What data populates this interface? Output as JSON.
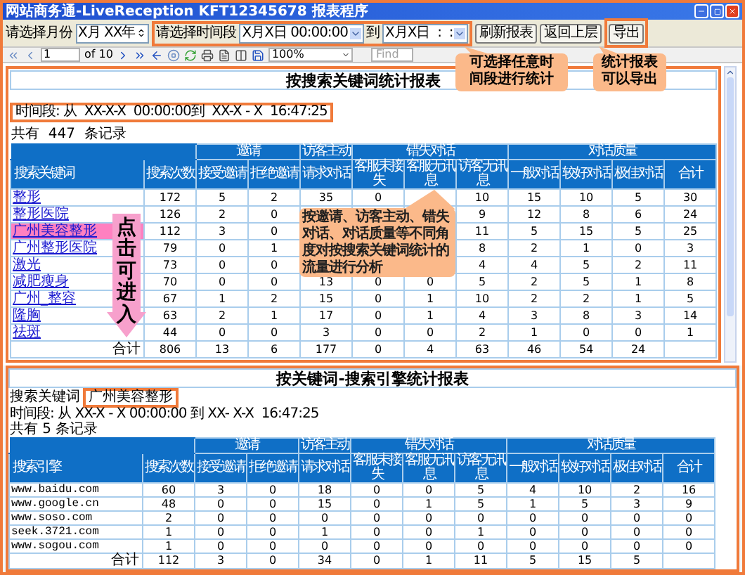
{
  "window": {
    "title": "网站商务通-LiveReception KFT12345678 报表程序"
  },
  "toolbar": {
    "month_label": "请选择月份",
    "month_value": "X月 XX年",
    "period_label": "请选择时间段",
    "period_from": "X月X日 00:00:00",
    "to_label": "到",
    "period_to": "X月X日  :  :",
    "buttons": [
      "刷新报表",
      "返回上层",
      "导出"
    ]
  },
  "report_toolbar": {
    "page": "1",
    "page_count": "of 10",
    "zoom": "100%",
    "find": "Find"
  },
  "callouts": [
    "可选择任意时间段进行统计",
    "统计报表可以导出",
    "按邀请、访客主动、错失对话、对话质量等不同角度对按搜索关键词统计的流量进行分析"
  ],
  "arrow": {
    "label": "点击可进入"
  },
  "report1": {
    "title": "按搜索关键词统计报表",
    "time_range": "时间段: 从  XX-X-X  00:00:00到  XX-X - X  16:47:25",
    "record_count": "共有  447  条记录",
    "columns": [
      {
        "label": "搜索关键词"
      },
      {
        "label": "搜索次数"
      },
      {
        "group": "邀请",
        "columns": [
          {
            "label": "接受邀请"
          },
          {
            "label": "拒绝邀请"
          }
        ]
      },
      {
        "group": "访客主动",
        "columns": [
          {
            "label": "请求对话"
          }
        ]
      },
      {
        "group": "错失对话",
        "columns": [
          {
            "label": "客服未接失"
          },
          {
            "label": "客服无讯息"
          },
          {
            "label": "访客无讯息"
          }
        ]
      },
      {
        "group": "对话质量",
        "columns": [
          {
            "label": "一般对话"
          },
          {
            "label": "较好对话"
          },
          {
            "label": "极佳对话"
          },
          {
            "label": "合计"
          }
        ]
      }
    ],
    "rows": [
      {
        "label": "整形",
        "selected": false,
        "cells": {
          "count": "172",
          "accept": "5",
          "decline": "2",
          "request": "35",
          "agent_missed": "0",
          "visitor_silent": "10",
          "normal": "15",
          "good": "10",
          "excellent": "5",
          "total": "30"
        }
      },
      {
        "label": "整形医院",
        "selected": false,
        "cells": {
          "count": "126",
          "accept": "2",
          "decline": "0",
          "visitor_silent": "9",
          "normal": "12",
          "good": "8",
          "excellent": "6",
          "total": "24"
        }
      },
      {
        "label": "广州美容整形",
        "selected": true,
        "cells": {
          "count": "112",
          "accept": "3",
          "decline": "0",
          "visitor_silent": "11",
          "normal": "5",
          "good": "15",
          "excellent": "5",
          "total": "25"
        }
      },
      {
        "label": "广州整形医院",
        "selected": false,
        "cells": {
          "count": "79",
          "accept": "0",
          "decline": "1",
          "visitor_silent": "8",
          "normal": "2",
          "good": "1",
          "excellent": "0",
          "total": "3"
        }
      },
      {
        "label": "激光",
        "selected": false,
        "cells": {
          "count": "73",
          "accept": "0",
          "decline": "0",
          "visitor_silent": "4",
          "normal": "4",
          "good": "5",
          "excellent": "2",
          "total": "11"
        }
      },
      {
        "label": "减肥瘦身",
        "selected": false,
        "cells": {
          "count": "70",
          "accept": "0",
          "decline": "0",
          "request": "13",
          "agent_missed": "0",
          "agent_silent": "0",
          "visitor_silent": "5",
          "normal": "2",
          "good": "5",
          "excellent": "1",
          "total": "8"
        }
      },
      {
        "label": "广州_整容",
        "selected": false,
        "cells": {
          "count": "67",
          "accept": "1",
          "decline": "2",
          "request": "15",
          "agent_missed": "0",
          "agent_silent": "1",
          "visitor_silent": "10",
          "normal": "2",
          "good": "2",
          "excellent": "1",
          "total": "5"
        }
      },
      {
        "label": "隆胸",
        "selected": false,
        "cells": {
          "count": "63",
          "accept": "2",
          "decline": "1",
          "request": "17",
          "agent_missed": "0",
          "agent_silent": "1",
          "visitor_silent": "4",
          "normal": "3",
          "good": "8",
          "excellent": "3",
          "total": "14"
        }
      },
      {
        "label": "祛斑",
        "selected": false,
        "cells": {
          "count": "44",
          "accept": "0",
          "decline": "0",
          "request": "3",
          "agent_missed": "0",
          "agent_silent": "0",
          "visitor_silent": "2",
          "normal": "1",
          "good": "0",
          "excellent": "0",
          "total": "1"
        }
      }
    ],
    "total": {
      "label": "合计",
      "cells": {
        "count": "806",
        "accept": "13",
        "decline": "6",
        "request": "177",
        "agent_missed": "0",
        "agent_silent": "4",
        "visitor_silent": "63",
        "normal": "46",
        "good": "54",
        "excellent": "24"
      }
    }
  },
  "report2": {
    "title": "按关键词-搜索引擎统计报表",
    "keyword_label": "搜索关键词",
    "keyword": "广州美容整形",
    "time_range": "时间段: 从 XX-X - X 00:00:00 到 XX- X-X  16:47:25",
    "record_count": "共有 5 条记录",
    "columns": [
      {
        "label": "搜索引擎"
      },
      {
        "label": "搜索次数"
      },
      {
        "group": "邀请",
        "columns": [
          {
            "label": "接受邀请"
          },
          {
            "label": "拒绝邀请"
          }
        ]
      },
      {
        "group": "访客主动",
        "columns": [
          {
            "label": "请求对话"
          }
        ]
      },
      {
        "group": "错失对话",
        "columns": [
          {
            "label": "客服未接失"
          },
          {
            "label": "客服无讯息"
          },
          {
            "label": "访客无讯息"
          }
        ]
      },
      {
        "group": "对话质量",
        "columns": [
          {
            "label": "一般对话"
          },
          {
            "label": "较好对话"
          },
          {
            "label": "极佳对话"
          },
          {
            "label": "合计"
          }
        ]
      }
    ],
    "rows": [
      {
        "label": "www.baidu.com",
        "cells": {
          "count": "60",
          "accept": "3",
          "decline": "0",
          "request": "18",
          "agent_missed": "0",
          "agent_silent": "0",
          "visitor_silent": "5",
          "normal": "4",
          "good": "10",
          "excellent": "2",
          "total": "16"
        }
      },
      {
        "label": "www.google.cn",
        "cells": {
          "count": "48",
          "accept": "0",
          "decline": "0",
          "request": "15",
          "agent_missed": "0",
          "agent_silent": "1",
          "visitor_silent": "5",
          "normal": "1",
          "good": "5",
          "excellent": "3",
          "total": "9"
        }
      },
      {
        "label": "www.soso.com",
        "cells": {
          "count": "2",
          "accept": "0",
          "decline": "0",
          "request": "0",
          "agent_missed": "0",
          "agent_silent": "0",
          "visitor_silent": "0",
          "normal": "0",
          "good": "0",
          "excellent": "0",
          "total": "0"
        }
      },
      {
        "label": "seek.3721.com",
        "cells": {
          "count": "1",
          "accept": "0",
          "decline": "0",
          "request": "1",
          "agent_missed": "0",
          "agent_silent": "0",
          "visitor_silent": "1",
          "normal": "0",
          "good": "0",
          "excellent": "0",
          "total": "0"
        }
      },
      {
        "label": "www.sogou.com",
        "cells": {
          "count": "1",
          "accept": "0",
          "decline": "0",
          "request": "0",
          "agent_missed": "0",
          "agent_silent": "0",
          "visitor_silent": "0",
          "normal": "0",
          "good": "0",
          "excellent": "0",
          "total": "0"
        }
      }
    ],
    "total": {
      "label": "合计",
      "cells": {
        "count": "112",
        "accept": "3",
        "decline": "0",
        "request": "34",
        "agent_missed": "0",
        "agent_silent": "1",
        "visitor_silent": "11",
        "normal": "5",
        "good": "15",
        "excellent": "5"
      }
    }
  }
}
